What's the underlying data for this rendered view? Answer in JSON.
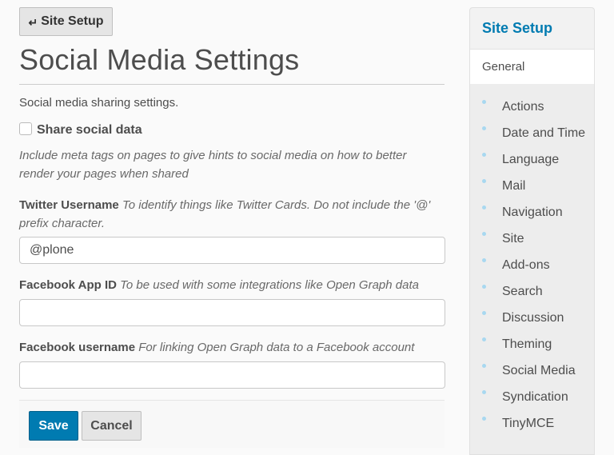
{
  "header": {
    "back_button_label": "Site Setup",
    "back_icon": "return-arrow-icon",
    "back_icon_glyph": "↵",
    "title": "Social Media Settings",
    "description": "Social media sharing settings."
  },
  "form": {
    "share_social_data": {
      "label": "Share social data",
      "checked": false,
      "help": "Include meta tags on pages to give hints to social media on how to better render your pages when shared"
    },
    "twitter_username": {
      "label": "Twitter Username",
      "help": "To identify things like Twitter Cards. Do not include the '@' prefix character.",
      "value": "@plone",
      "placeholder": ""
    },
    "facebook_app_id": {
      "label": "Facebook App ID",
      "help": "To be used with some integrations like Open Graph data",
      "value": "",
      "placeholder": ""
    },
    "facebook_username": {
      "label": "Facebook username",
      "help": "For linking Open Graph data to a Facebook account",
      "value": "",
      "placeholder": ""
    },
    "save_label": "Save",
    "cancel_label": "Cancel"
  },
  "sidebar": {
    "title": "Site Setup",
    "general_label": "General",
    "items": [
      {
        "label": "Actions"
      },
      {
        "label": "Date and Time"
      },
      {
        "label": "Language"
      },
      {
        "label": "Mail"
      },
      {
        "label": "Navigation"
      },
      {
        "label": "Site"
      },
      {
        "label": "Add-ons"
      },
      {
        "label": "Search"
      },
      {
        "label": "Discussion"
      },
      {
        "label": "Theming"
      },
      {
        "label": "Social Media"
      },
      {
        "label": "Syndication"
      },
      {
        "label": "TinyMCE"
      }
    ]
  },
  "colors": {
    "accent": "#007bb1",
    "bullet": "#a8d8f0",
    "background": "#fafafa",
    "sidebar_bg": "#ededed"
  }
}
